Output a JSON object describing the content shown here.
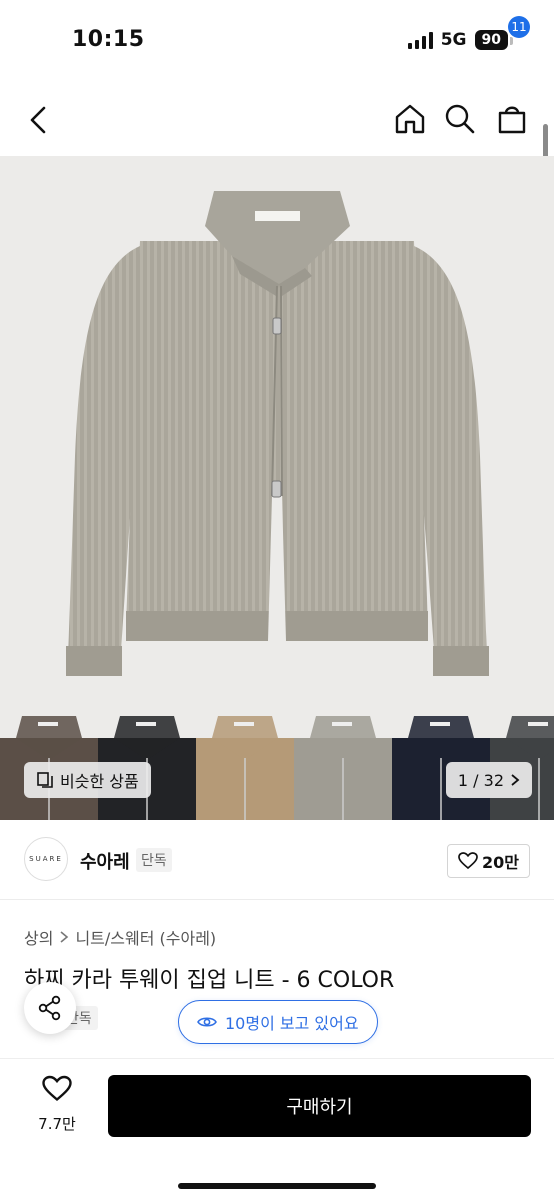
{
  "status_bar": {
    "time": "10:15",
    "network": "5G",
    "battery": "90"
  },
  "nav": {
    "cart_count": "11",
    "icons": [
      "back-icon",
      "home-icon",
      "search-icon",
      "cart-icon"
    ]
  },
  "hero": {
    "product_label": "SUARE"
  },
  "thumbnails": {
    "colors": [
      "#5b4f47",
      "#222326",
      "#b59a77",
      "#9f9c93",
      "#1c2130",
      "#3f4244"
    ],
    "similar_label": "비슷한 상품",
    "page_indicator": "1 / 32"
  },
  "brand": {
    "logo_text": "SUARE",
    "name": "수아레",
    "tag": "단독",
    "likes": "20만"
  },
  "breadcrumb": {
    "level1": "상의",
    "level2": "니트/스웨터 (수아레)"
  },
  "product": {
    "title": "하찌 카라 투웨이 집업 니트 - 6 COLOR",
    "exclusive": "단독",
    "viewers_text": "10명이 보고 있어요"
  },
  "bottom_bar": {
    "wish_count": "7.7만",
    "buy_label": "구매하기"
  }
}
